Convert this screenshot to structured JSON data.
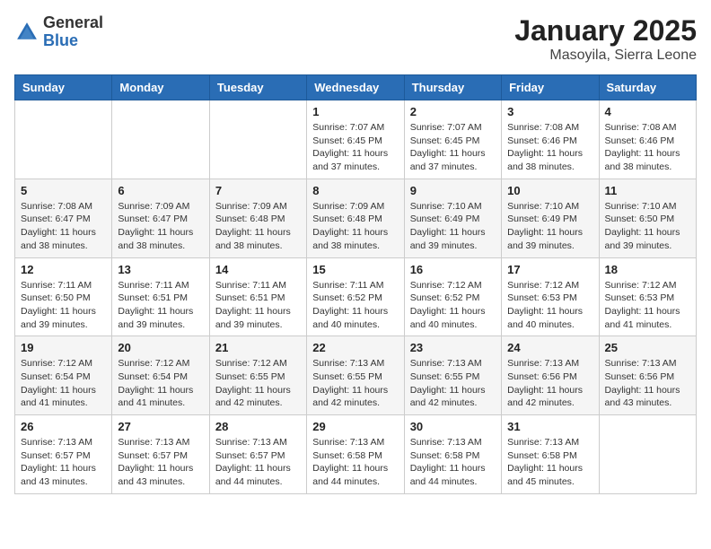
{
  "header": {
    "logo_general": "General",
    "logo_blue": "Blue",
    "title": "January 2025",
    "location": "Masoyila, Sierra Leone"
  },
  "days_of_week": [
    "Sunday",
    "Monday",
    "Tuesday",
    "Wednesday",
    "Thursday",
    "Friday",
    "Saturday"
  ],
  "weeks": [
    [
      {
        "day": "",
        "sunrise": "",
        "sunset": "",
        "daylight": ""
      },
      {
        "day": "",
        "sunrise": "",
        "sunset": "",
        "daylight": ""
      },
      {
        "day": "",
        "sunrise": "",
        "sunset": "",
        "daylight": ""
      },
      {
        "day": "1",
        "sunrise": "Sunrise: 7:07 AM",
        "sunset": "Sunset: 6:45 PM",
        "daylight": "Daylight: 11 hours and 37 minutes."
      },
      {
        "day": "2",
        "sunrise": "Sunrise: 7:07 AM",
        "sunset": "Sunset: 6:45 PM",
        "daylight": "Daylight: 11 hours and 37 minutes."
      },
      {
        "day": "3",
        "sunrise": "Sunrise: 7:08 AM",
        "sunset": "Sunset: 6:46 PM",
        "daylight": "Daylight: 11 hours and 38 minutes."
      },
      {
        "day": "4",
        "sunrise": "Sunrise: 7:08 AM",
        "sunset": "Sunset: 6:46 PM",
        "daylight": "Daylight: 11 hours and 38 minutes."
      }
    ],
    [
      {
        "day": "5",
        "sunrise": "Sunrise: 7:08 AM",
        "sunset": "Sunset: 6:47 PM",
        "daylight": "Daylight: 11 hours and 38 minutes."
      },
      {
        "day": "6",
        "sunrise": "Sunrise: 7:09 AM",
        "sunset": "Sunset: 6:47 PM",
        "daylight": "Daylight: 11 hours and 38 minutes."
      },
      {
        "day": "7",
        "sunrise": "Sunrise: 7:09 AM",
        "sunset": "Sunset: 6:48 PM",
        "daylight": "Daylight: 11 hours and 38 minutes."
      },
      {
        "day": "8",
        "sunrise": "Sunrise: 7:09 AM",
        "sunset": "Sunset: 6:48 PM",
        "daylight": "Daylight: 11 hours and 38 minutes."
      },
      {
        "day": "9",
        "sunrise": "Sunrise: 7:10 AM",
        "sunset": "Sunset: 6:49 PM",
        "daylight": "Daylight: 11 hours and 39 minutes."
      },
      {
        "day": "10",
        "sunrise": "Sunrise: 7:10 AM",
        "sunset": "Sunset: 6:49 PM",
        "daylight": "Daylight: 11 hours and 39 minutes."
      },
      {
        "day": "11",
        "sunrise": "Sunrise: 7:10 AM",
        "sunset": "Sunset: 6:50 PM",
        "daylight": "Daylight: 11 hours and 39 minutes."
      }
    ],
    [
      {
        "day": "12",
        "sunrise": "Sunrise: 7:11 AM",
        "sunset": "Sunset: 6:50 PM",
        "daylight": "Daylight: 11 hours and 39 minutes."
      },
      {
        "day": "13",
        "sunrise": "Sunrise: 7:11 AM",
        "sunset": "Sunset: 6:51 PM",
        "daylight": "Daylight: 11 hours and 39 minutes."
      },
      {
        "day": "14",
        "sunrise": "Sunrise: 7:11 AM",
        "sunset": "Sunset: 6:51 PM",
        "daylight": "Daylight: 11 hours and 39 minutes."
      },
      {
        "day": "15",
        "sunrise": "Sunrise: 7:11 AM",
        "sunset": "Sunset: 6:52 PM",
        "daylight": "Daylight: 11 hours and 40 minutes."
      },
      {
        "day": "16",
        "sunrise": "Sunrise: 7:12 AM",
        "sunset": "Sunset: 6:52 PM",
        "daylight": "Daylight: 11 hours and 40 minutes."
      },
      {
        "day": "17",
        "sunrise": "Sunrise: 7:12 AM",
        "sunset": "Sunset: 6:53 PM",
        "daylight": "Daylight: 11 hours and 40 minutes."
      },
      {
        "day": "18",
        "sunrise": "Sunrise: 7:12 AM",
        "sunset": "Sunset: 6:53 PM",
        "daylight": "Daylight: 11 hours and 41 minutes."
      }
    ],
    [
      {
        "day": "19",
        "sunrise": "Sunrise: 7:12 AM",
        "sunset": "Sunset: 6:54 PM",
        "daylight": "Daylight: 11 hours and 41 minutes."
      },
      {
        "day": "20",
        "sunrise": "Sunrise: 7:12 AM",
        "sunset": "Sunset: 6:54 PM",
        "daylight": "Daylight: 11 hours and 41 minutes."
      },
      {
        "day": "21",
        "sunrise": "Sunrise: 7:12 AM",
        "sunset": "Sunset: 6:55 PM",
        "daylight": "Daylight: 11 hours and 42 minutes."
      },
      {
        "day": "22",
        "sunrise": "Sunrise: 7:13 AM",
        "sunset": "Sunset: 6:55 PM",
        "daylight": "Daylight: 11 hours and 42 minutes."
      },
      {
        "day": "23",
        "sunrise": "Sunrise: 7:13 AM",
        "sunset": "Sunset: 6:55 PM",
        "daylight": "Daylight: 11 hours and 42 minutes."
      },
      {
        "day": "24",
        "sunrise": "Sunrise: 7:13 AM",
        "sunset": "Sunset: 6:56 PM",
        "daylight": "Daylight: 11 hours and 42 minutes."
      },
      {
        "day": "25",
        "sunrise": "Sunrise: 7:13 AM",
        "sunset": "Sunset: 6:56 PM",
        "daylight": "Daylight: 11 hours and 43 minutes."
      }
    ],
    [
      {
        "day": "26",
        "sunrise": "Sunrise: 7:13 AM",
        "sunset": "Sunset: 6:57 PM",
        "daylight": "Daylight: 11 hours and 43 minutes."
      },
      {
        "day": "27",
        "sunrise": "Sunrise: 7:13 AM",
        "sunset": "Sunset: 6:57 PM",
        "daylight": "Daylight: 11 hours and 43 minutes."
      },
      {
        "day": "28",
        "sunrise": "Sunrise: 7:13 AM",
        "sunset": "Sunset: 6:57 PM",
        "daylight": "Daylight: 11 hours and 44 minutes."
      },
      {
        "day": "29",
        "sunrise": "Sunrise: 7:13 AM",
        "sunset": "Sunset: 6:58 PM",
        "daylight": "Daylight: 11 hours and 44 minutes."
      },
      {
        "day": "30",
        "sunrise": "Sunrise: 7:13 AM",
        "sunset": "Sunset: 6:58 PM",
        "daylight": "Daylight: 11 hours and 44 minutes."
      },
      {
        "day": "31",
        "sunrise": "Sunrise: 7:13 AM",
        "sunset": "Sunset: 6:58 PM",
        "daylight": "Daylight: 11 hours and 45 minutes."
      },
      {
        "day": "",
        "sunrise": "",
        "sunset": "",
        "daylight": ""
      }
    ]
  ]
}
